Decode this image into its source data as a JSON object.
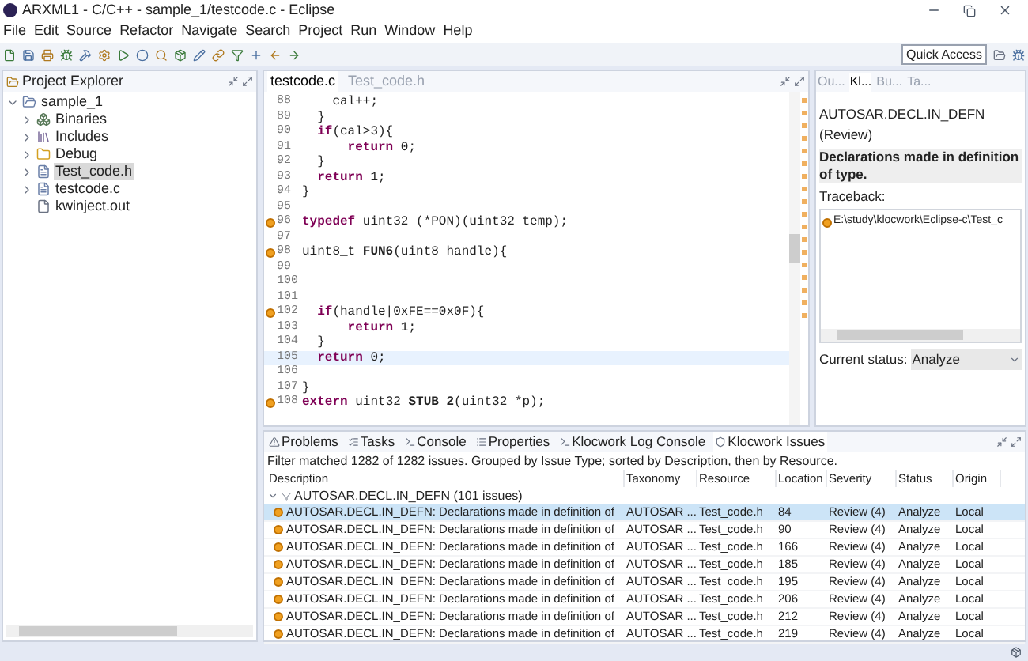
{
  "window": {
    "title": "ARXML1 - C/C++ - sample_1/testcode.c - Eclipse"
  },
  "menu": [
    "File",
    "Edit",
    "Source",
    "Refactor",
    "Navigate",
    "Search",
    "Project",
    "Run",
    "Window",
    "Help"
  ],
  "toolbar": {
    "quick_access": "Quick Access"
  },
  "project_explorer": {
    "title": "Project Explorer",
    "tree": [
      {
        "label": "sample_1",
        "kind": "project",
        "expanded": true,
        "selected": false,
        "children": [
          {
            "label": "Binaries",
            "kind": "binaries",
            "expanded": false,
            "selected": false
          },
          {
            "label": "Includes",
            "kind": "includes",
            "expanded": false,
            "selected": false
          },
          {
            "label": "Debug",
            "kind": "folder",
            "expanded": false,
            "selected": false
          },
          {
            "label": "Test_code.h",
            "kind": "header",
            "expanded": false,
            "selected": true
          },
          {
            "label": "testcode.c",
            "kind": "source",
            "expanded": false,
            "selected": false
          },
          {
            "label": "kwinject.out",
            "kind": "file",
            "selected": false
          }
        ]
      }
    ]
  },
  "editor": {
    "tabs": [
      {
        "label": "testcode.c",
        "selected": true
      },
      {
        "label": "Test_code.h",
        "selected": false
      }
    ],
    "lines": [
      {
        "number": "88",
        "current": false,
        "warning": false,
        "tokens": [
          {
            "text": "    cal++;",
            "kind": "text"
          }
        ]
      },
      {
        "number": "89",
        "current": false,
        "warning": false,
        "tokens": [
          {
            "text": "  }",
            "kind": "text"
          }
        ]
      },
      {
        "number": "90",
        "current": false,
        "warning": false,
        "tokens": [
          {
            "text": "  if",
            "kind": "keyword"
          },
          {
            "text": "(cal>3){",
            "kind": "text"
          }
        ]
      },
      {
        "number": "91",
        "current": false,
        "warning": false,
        "tokens": [
          {
            "text": "      return",
            "kind": "keyword"
          },
          {
            "text": " 0;",
            "kind": "text"
          }
        ]
      },
      {
        "number": "92",
        "current": false,
        "warning": false,
        "tokens": [
          {
            "text": "  }",
            "kind": "text"
          }
        ]
      },
      {
        "number": "93",
        "current": false,
        "warning": false,
        "tokens": [
          {
            "text": "  return",
            "kind": "keyword"
          },
          {
            "text": " 1;",
            "kind": "text"
          }
        ]
      },
      {
        "number": "94",
        "current": false,
        "warning": false,
        "tokens": [
          {
            "text": "}",
            "kind": "text"
          }
        ]
      },
      {
        "number": "95",
        "current": false,
        "warning": false
      },
      {
        "number": "96",
        "current": false,
        "warning": true,
        "tokens": [
          {
            "text": "typedef",
            "kind": "keyword"
          },
          {
            "text": " uint32 (*PON)(uint32 temp);",
            "kind": "text"
          }
        ]
      },
      {
        "number": "97",
        "current": false,
        "warning": false
      },
      {
        "number": "98",
        "current": false,
        "warning": true,
        "tokens": [
          {
            "text": "uint8_t ",
            "kind": "text"
          },
          {
            "text": "FUN6",
            "kind": "bold"
          },
          {
            "text": "(uint8 handle){",
            "kind": "text"
          }
        ]
      },
      {
        "number": "99",
        "current": false,
        "warning": false
      },
      {
        "number": "100",
        "current": false,
        "warning": false
      },
      {
        "number": "101",
        "current": false,
        "warning": false
      },
      {
        "number": "102",
        "current": false,
        "warning": true,
        "tokens": [
          {
            "text": "  if",
            "kind": "keyword"
          },
          {
            "text": "(handle|0xFE==0x0F){",
            "kind": "text"
          }
        ]
      },
      {
        "number": "103",
        "current": false,
        "warning": false,
        "tokens": [
          {
            "text": "      return",
            "kind": "keyword"
          },
          {
            "text": " 1;",
            "kind": "text"
          }
        ]
      },
      {
        "number": "104",
        "current": false,
        "warning": false,
        "tokens": [
          {
            "text": "  }",
            "kind": "text"
          }
        ]
      },
      {
        "number": "105",
        "current": true,
        "warning": false,
        "tokens": [
          {
            "text": "  return",
            "kind": "keyword"
          },
          {
            "text": " 0;",
            "kind": "text"
          }
        ]
      },
      {
        "number": "106",
        "current": false,
        "warning": false
      },
      {
        "number": "107",
        "current": false,
        "warning": false,
        "tokens": [
          {
            "text": "}",
            "kind": "text"
          }
        ]
      },
      {
        "number": "108",
        "current": false,
        "warning": true,
        "tokens": [
          {
            "text": "extern",
            "kind": "keyword"
          },
          {
            "text": " uint32 ",
            "kind": "text"
          },
          {
            "text": "STUB 2",
            "kind": "bold"
          },
          {
            "text": "(uint32 *p);",
            "kind": "text"
          }
        ]
      }
    ]
  },
  "side_panel": {
    "tabs": [
      {
        "label": "Ou...",
        "selected": false
      },
      {
        "label": "Kl...",
        "selected": true
      },
      {
        "label": "Bu...",
        "selected": false
      },
      {
        "label": "Ta...",
        "selected": false
      }
    ],
    "issue_title": "AUTOSAR.DECL.IN_DEFN (Review)",
    "message": "Declarations made in definition of type.",
    "traceback_label": "Traceback:",
    "traceback": [
      "E:\\study\\klocwork\\Eclipse-c\\Test_c"
    ],
    "status_label": "Current status:",
    "status_value": "Analyze"
  },
  "issues_panel": {
    "tabs": [
      {
        "label": "Problems",
        "selected": false
      },
      {
        "label": "Tasks",
        "selected": false
      },
      {
        "label": "Console",
        "selected": false
      },
      {
        "label": "Properties",
        "selected": false
      },
      {
        "label": "Klocwork Log Console",
        "selected": false
      },
      {
        "label": "Klocwork Issues",
        "selected": true
      }
    ],
    "filter_text": "Filter matched 1282 of 1282 issues. Grouped by Issue Type; sorted by Description, then by Resource.",
    "columns": [
      "Description",
      "Taxonomy",
      "Resource",
      "Location",
      "Severity",
      "Status",
      "Origin"
    ],
    "group": {
      "label": "AUTOSAR.DECL.IN_DEFN (101 issues)",
      "expanded": true
    },
    "rows": [
      {
        "description": "AUTOSAR.DECL.IN_DEFN: Declarations made in definition of",
        "taxonomy": "AUTOSAR ...",
        "resource": "Test_code.h",
        "location": "84",
        "severity": "Review (4)",
        "status": "Analyze",
        "origin": "Local",
        "selected": true
      },
      {
        "description": "AUTOSAR.DECL.IN_DEFN: Declarations made in definition of",
        "taxonomy": "AUTOSAR ...",
        "resource": "Test_code.h",
        "location": "90",
        "severity": "Review (4)",
        "status": "Analyze",
        "origin": "Local",
        "selected": false
      },
      {
        "description": "AUTOSAR.DECL.IN_DEFN: Declarations made in definition of",
        "taxonomy": "AUTOSAR ...",
        "resource": "Test_code.h",
        "location": "166",
        "severity": "Review (4)",
        "status": "Analyze",
        "origin": "Local",
        "selected": false
      },
      {
        "description": "AUTOSAR.DECL.IN_DEFN: Declarations made in definition of",
        "taxonomy": "AUTOSAR ...",
        "resource": "Test_code.h",
        "location": "185",
        "severity": "Review (4)",
        "status": "Analyze",
        "origin": "Local",
        "selected": false
      },
      {
        "description": "AUTOSAR.DECL.IN_DEFN: Declarations made in definition of",
        "taxonomy": "AUTOSAR ...",
        "resource": "Test_code.h",
        "location": "195",
        "severity": "Review (4)",
        "status": "Analyze",
        "origin": "Local",
        "selected": false
      },
      {
        "description": "AUTOSAR.DECL.IN_DEFN: Declarations made in definition of",
        "taxonomy": "AUTOSAR ...",
        "resource": "Test_code.h",
        "location": "206",
        "severity": "Review (4)",
        "status": "Analyze",
        "origin": "Local",
        "selected": false
      },
      {
        "description": "AUTOSAR.DECL.IN_DEFN: Declarations made in definition of",
        "taxonomy": "AUTOSAR ...",
        "resource": "Test_code.h",
        "location": "212",
        "severity": "Review (4)",
        "status": "Analyze",
        "origin": "Local",
        "selected": false
      },
      {
        "description": "AUTOSAR.DECL.IN_DEFN: Declarations made in definition of",
        "taxonomy": "AUTOSAR ...",
        "resource": "Test_code.h",
        "location": "219",
        "severity": "Review (4)",
        "status": "Analyze",
        "origin": "Local",
        "selected": false
      }
    ]
  }
}
